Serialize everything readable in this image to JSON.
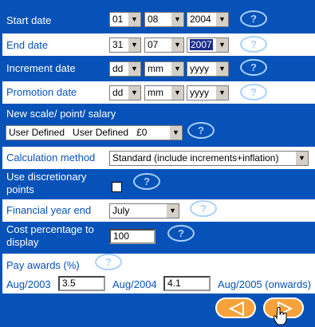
{
  "start_date": {
    "label": "Start date",
    "day": "01",
    "month": "08",
    "year": "2004"
  },
  "end_date": {
    "label": "End date",
    "day": "31",
    "month": "07",
    "year": "2007"
  },
  "increment_date": {
    "label": "Increment date",
    "day": "dd",
    "month": "mm",
    "year": "yyyy"
  },
  "promotion_date": {
    "label": "Promotion date",
    "day": "dd",
    "month": "mm",
    "year": "yyyy"
  },
  "new_scale": {
    "label": "New scale/ point/ salary",
    "value": "User Defined   User Defined   £0"
  },
  "calculation_method": {
    "label": "Calculation method",
    "value": "Standard (include increments+inflation)"
  },
  "discretionary": {
    "label_line1": "Use discretionary",
    "label_line2": "points",
    "checked": false
  },
  "financial_year_end": {
    "label": "Financial year end",
    "value": "July"
  },
  "cost_percentage": {
    "label_line1": "Cost percentage to",
    "label_line2": "display",
    "value": "100"
  },
  "pay_awards": {
    "label": "Pay awards (%)",
    "items": [
      {
        "label": "Aug/2003",
        "value": "3.5"
      },
      {
        "label": "Aug/2004",
        "value": "4.1"
      },
      {
        "label": "Aug/2005 (onwards)",
        "value": ""
      }
    ]
  },
  "help_symbol": "?",
  "colors": {
    "background": "#0752B8",
    "band": "#ffffff",
    "nav_button": "#f5a23a",
    "help_outline": "#aad0ff"
  },
  "icons": {
    "help": "help-icon",
    "back": "back-arrow-icon",
    "next": "next-arrow-icon",
    "cursor": "hand-cursor-icon"
  }
}
